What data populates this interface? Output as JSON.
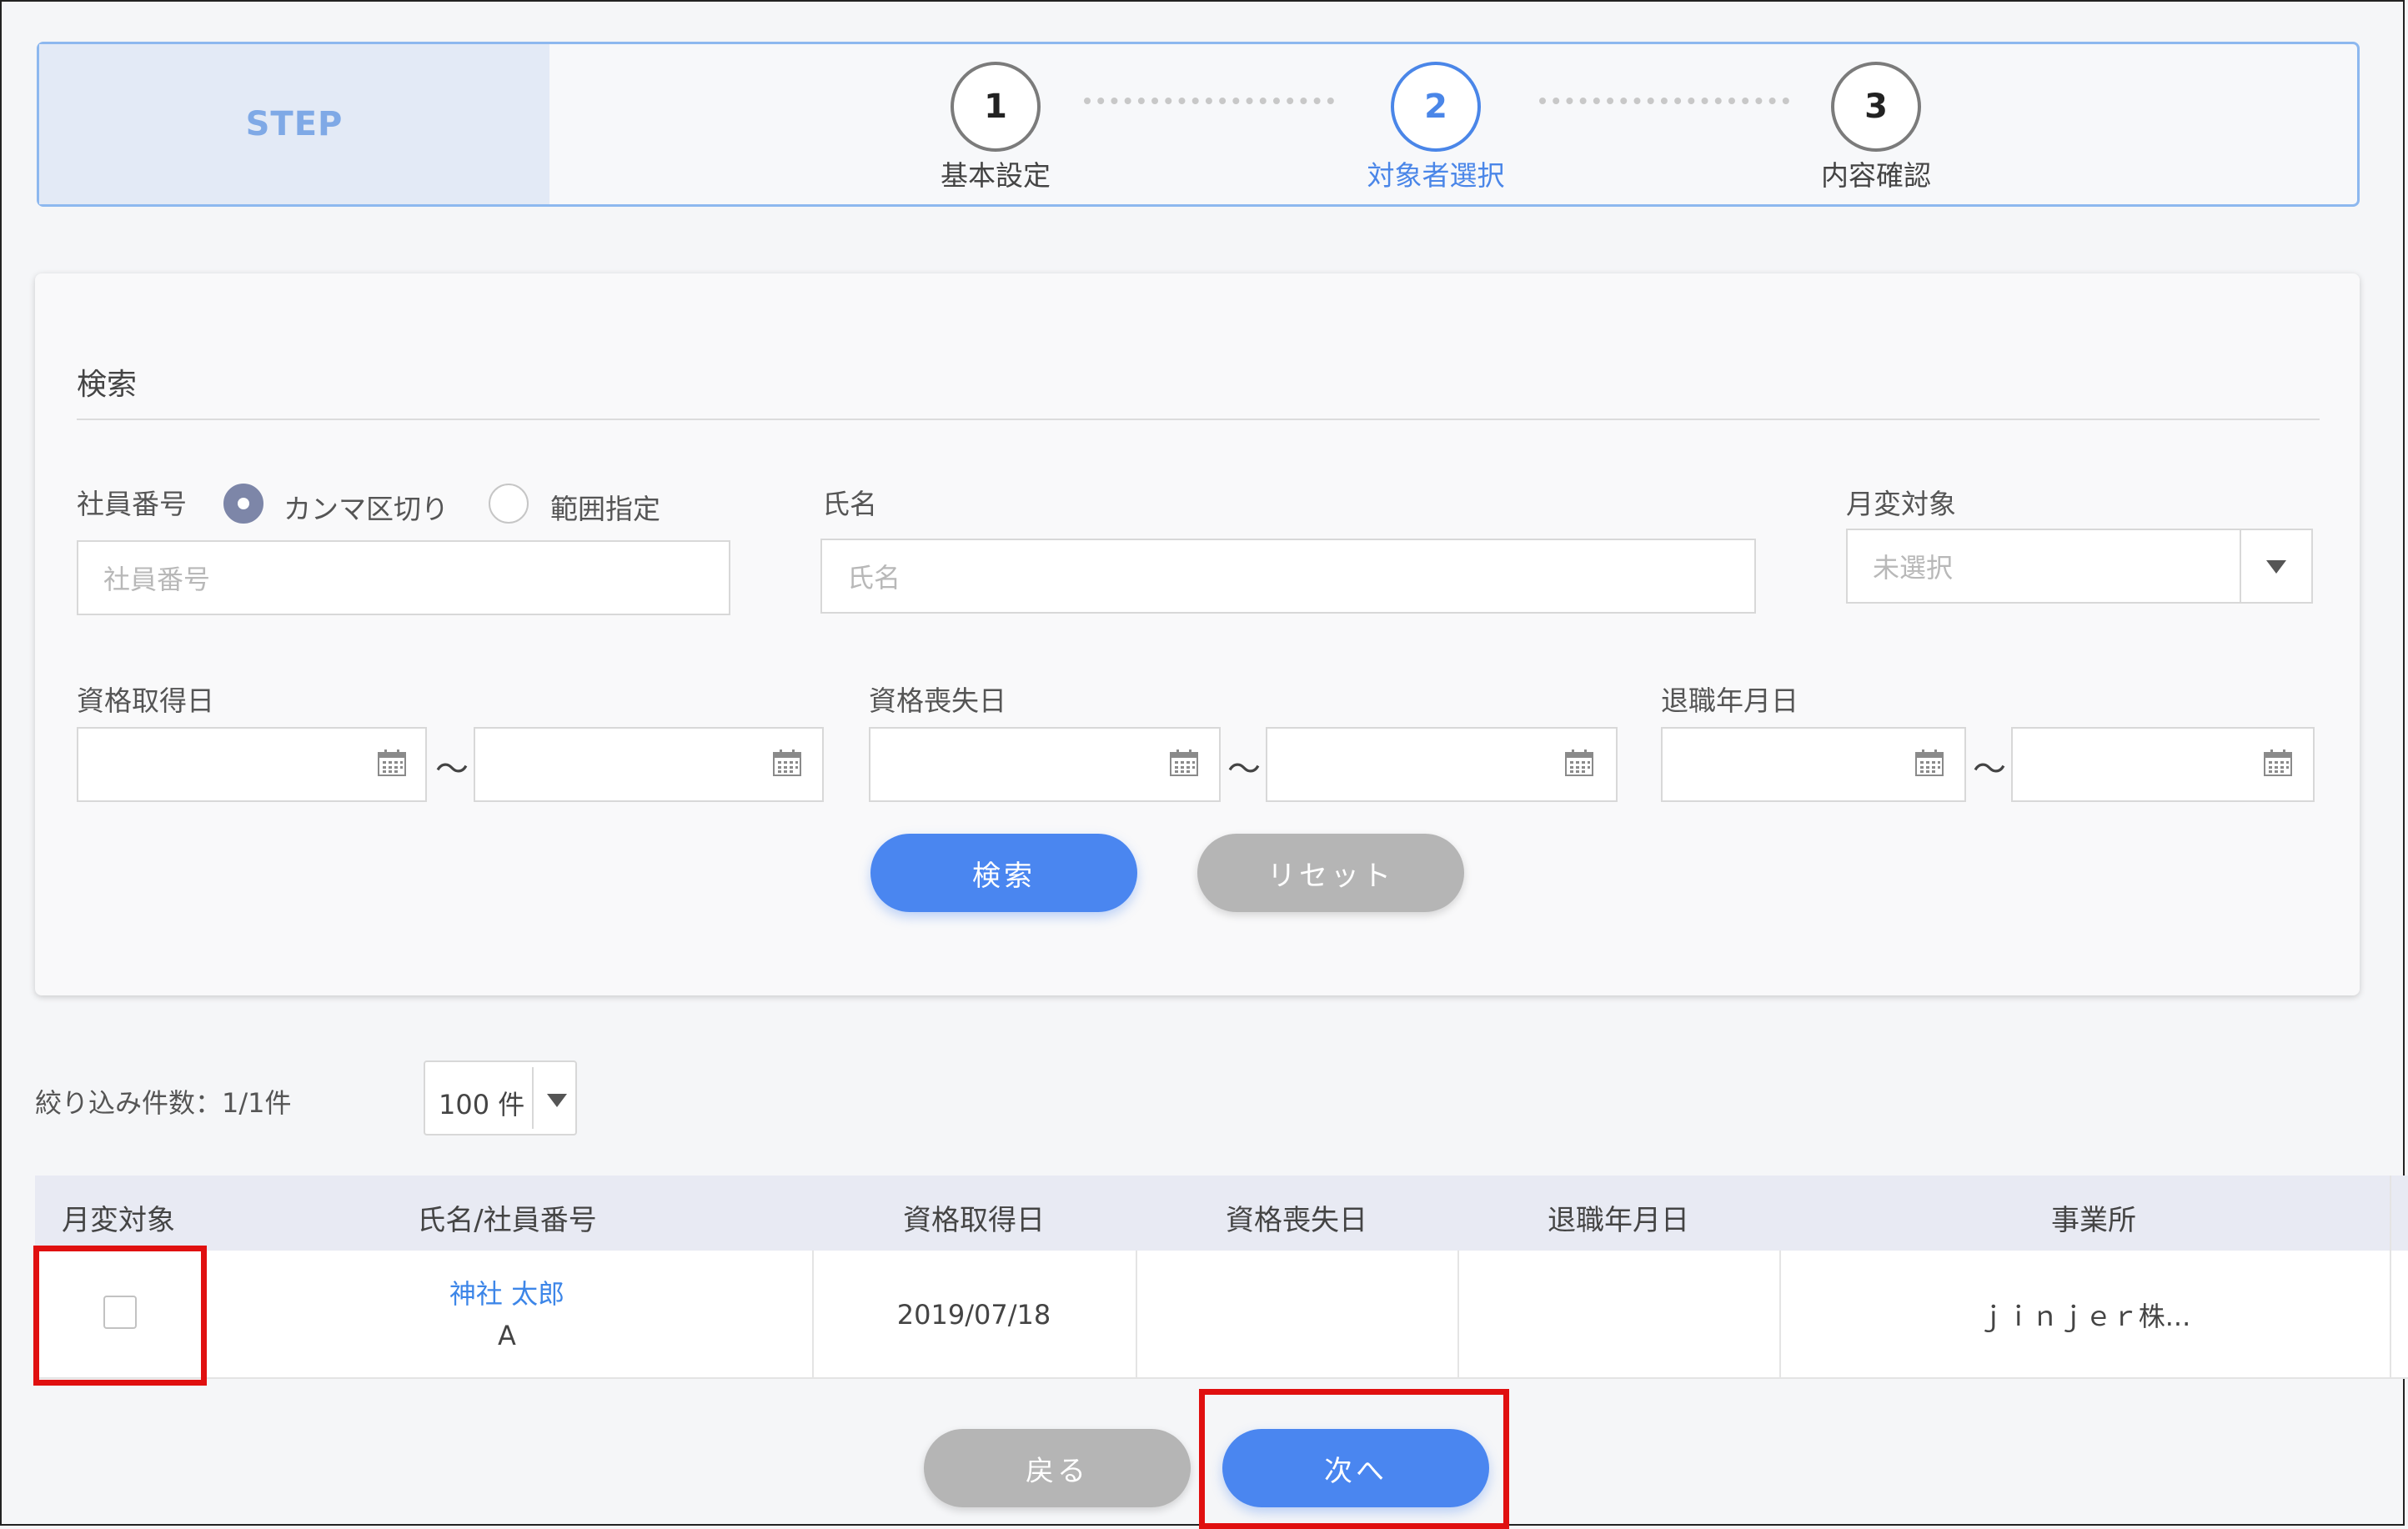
{
  "steps": {
    "header": "STEP",
    "items": [
      {
        "number": "1",
        "label": "基本設定"
      },
      {
        "number": "2",
        "label": "対象者選択"
      },
      {
        "number": "3",
        "label": "内容確認"
      }
    ]
  },
  "search": {
    "title": "検索",
    "employee_number": {
      "label": "社員番号",
      "radio_comma": "カンマ区切り",
      "radio_range": "範囲指定",
      "placeholder": "社員番号"
    },
    "name": {
      "label": "氏名",
      "placeholder": "氏名"
    },
    "monthly_change": {
      "label": "月変対象",
      "selected": "未選択"
    },
    "acquisition_date": {
      "label": "資格取得日"
    },
    "loss_date": {
      "label": "資格喪失日"
    },
    "retirement_date": {
      "label": "退職年月日"
    },
    "range_separator": "～",
    "search_button": "検索",
    "reset_button": "リセット"
  },
  "results": {
    "count_text": "絞り込み件数：1/1件",
    "per_page": "100 件",
    "columns": [
      "月変対象",
      "氏名/社員番号",
      "資格取得日",
      "資格喪失日",
      "退職年月日",
      "事業所"
    ],
    "rows": [
      {
        "name": "神社 太郎",
        "employee_number": "A",
        "acquisition_date": "2019/07/18",
        "loss_date": "",
        "retirement_date": "",
        "office": "ｊｉｎｊｅｒ株..."
      }
    ]
  },
  "footer": {
    "back_button": "戻る",
    "next_button": "次へ"
  },
  "colors": {
    "accent": "#4a86f0",
    "step_border": "#8db8ef",
    "highlight": "#e01010"
  }
}
